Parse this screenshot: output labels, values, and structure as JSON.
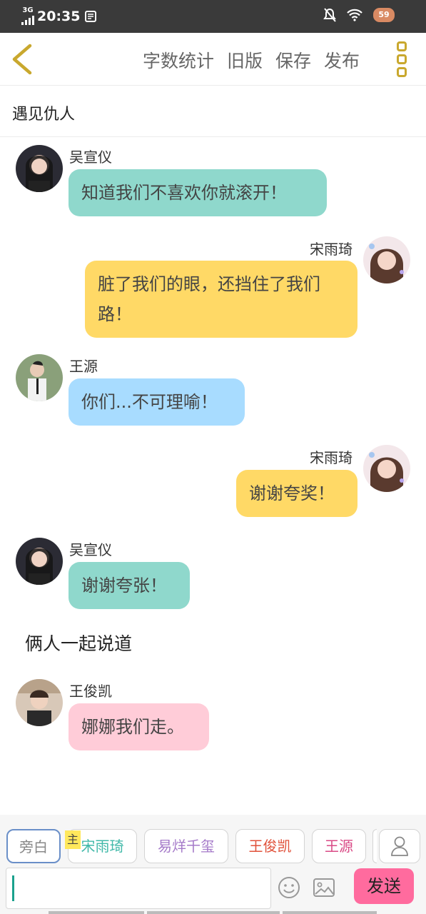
{
  "status_bar": {
    "network": "3G",
    "time": "20:35",
    "battery": "59"
  },
  "header": {
    "actions": [
      "字数统计",
      "旧版",
      "保存",
      "发布"
    ]
  },
  "chapter_title": "遇见仇人",
  "messages": [
    {
      "speaker": "吴宣仪",
      "text": "知道我们不喜欢你就滚开！",
      "bubble_color": "#8fd8cc"
    },
    {
      "speaker": "宋雨琦",
      "text": "脏了我们的眼，还挡住了我们路！",
      "bubble_color": "#ffd966"
    },
    {
      "speaker": "王源",
      "text": "你们...不可理喻！",
      "bubble_color": "#a8dcff"
    },
    {
      "speaker": "宋雨琦",
      "text": "谢谢夸奖！",
      "bubble_color": "#ffd966"
    },
    {
      "speaker": "吴宣仪",
      "text": "谢谢夸张！",
      "bubble_color": "#8fd8cc"
    },
    {
      "speaker": "王俊凯",
      "text": "娜娜我们走。",
      "bubble_color": "#ffccd8"
    }
  ],
  "narration": "俩人一起说道",
  "roles": [
    {
      "label": "旁白",
      "color": "#888888"
    },
    {
      "label": "宋雨琦",
      "color": "#3fb8a8"
    },
    {
      "label": "易烊千玺",
      "color": "#a57ac9"
    },
    {
      "label": "王俊凯",
      "color": "#e0513a"
    },
    {
      "label": "王源",
      "color": "#d94a86"
    }
  ],
  "main_marker": "主",
  "send_label": "发送",
  "input_placeholder": ""
}
